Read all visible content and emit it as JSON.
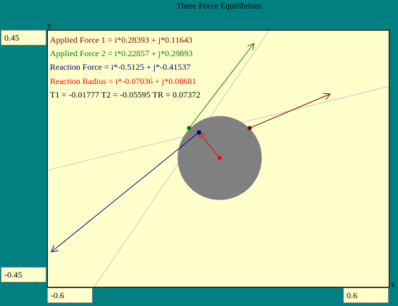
{
  "title": "Three Force  Equilibrium",
  "axes": {
    "x_label": "x",
    "y_label": "y"
  },
  "range_fields": {
    "y_max": "0.45",
    "y_min": "-0.45",
    "x_min": "-0.6",
    "x_max": "0.6"
  },
  "readouts": {
    "applied_force_1": "Applied Force 1 = i*0.28393 + j*0.11643",
    "applied_force_2": "Applied Force 2 = i*0.22857 + j*0.29893",
    "reaction_force": "Reaction Force = i*-0.5125 + j*-0.41537",
    "reaction_radius": "Reaction Radius = i*-0.07036 + j*0.08681",
    "torques": "T1 = -0.01777  T2 = -0.05595  TR = 0.07372"
  },
  "colors": {
    "applied_force_1": "#800000",
    "applied_force_2": "#008000",
    "reaction_force": "#000080",
    "reaction_radius": "#FF0000",
    "disk": "#808080",
    "background": "#008080",
    "panel": "#FFFFCC"
  }
}
